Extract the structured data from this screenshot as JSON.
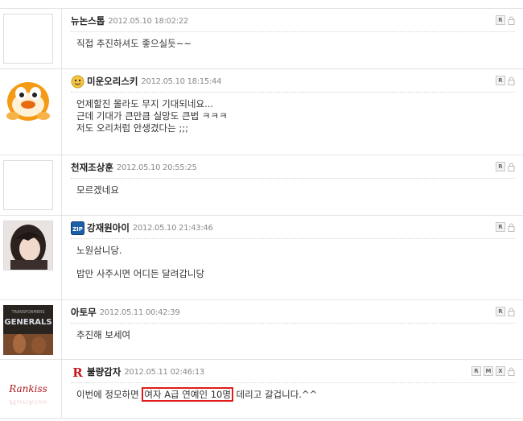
{
  "actions": {
    "reply": "R",
    "modify": "M",
    "delete": "X"
  },
  "comments": [
    {
      "author": "뉴논스톱",
      "date": "2012.05.10 18:02:22",
      "lines": [
        "직접 추진하셔도 좋으실듯~~"
      ]
    },
    {
      "author": "미운오리스키",
      "date": "2012.05.10 18:15:44",
      "lines": [
        "언제할진 몰라도 무지 기대되네요...",
        "근데 기대가 큰만큼 실망도 큰법 ㅋㅋㅋ",
        "저도 오리처럼 안생겼다는 ;;;"
      ]
    },
    {
      "author": "천재조상훈",
      "date": "2012.05.10 20:55:25",
      "lines": [
        "모르겠네요"
      ]
    },
    {
      "author": "강재원아이",
      "date": "2012.05.10 21:43:46",
      "badge": "ZIP",
      "lines": [
        "노원삼니당.",
        "밥만 사주시면 어디든 달려갑니당"
      ]
    },
    {
      "author": "아토무",
      "date": "2012.05.11 00:42:39",
      "avatar_text": "GENERALS",
      "avatar_subtext": "TRANSFORMERS",
      "lines": [
        "추진해 보세여"
      ]
    },
    {
      "author": "불량감자",
      "date": "2012.05.11 02:46:13",
      "badge": "R",
      "avatar_text": "Rankiss",
      "line_before": "이번에 정모하면 ",
      "line_highlight": "여자 A급 연예인 10명",
      "line_after": " 데리고 갈겁니다.^^"
    }
  ]
}
